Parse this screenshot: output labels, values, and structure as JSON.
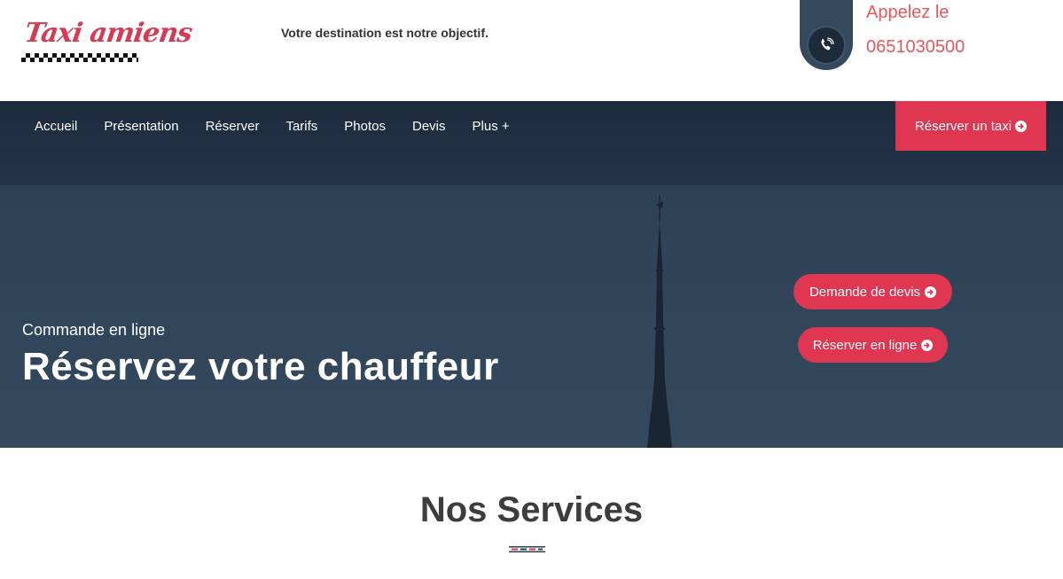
{
  "header": {
    "logo_text": "Taxi amiens",
    "tagline": "Votre destination est notre objectif.",
    "call_label": "Appelez le",
    "phone_number": "0651030500"
  },
  "nav": {
    "items": [
      "Accueil",
      "Présentation",
      "Réserver",
      "Tarifs",
      "Photos",
      "Devis",
      "Plus +"
    ],
    "cta_label": "Réserver un taxi"
  },
  "hero": {
    "subtitle": "Commande en ligne",
    "title": "Réservez votre chauffeur",
    "quote_button": "Demande de devis",
    "book_button": "Réserver en ligne"
  },
  "services": {
    "title": "Nos Services"
  },
  "colors": {
    "accent": "#df3651",
    "nav_bg": "#1d2b3d",
    "hero_bg": "#2f4457",
    "phone_text": "#e8575e"
  }
}
